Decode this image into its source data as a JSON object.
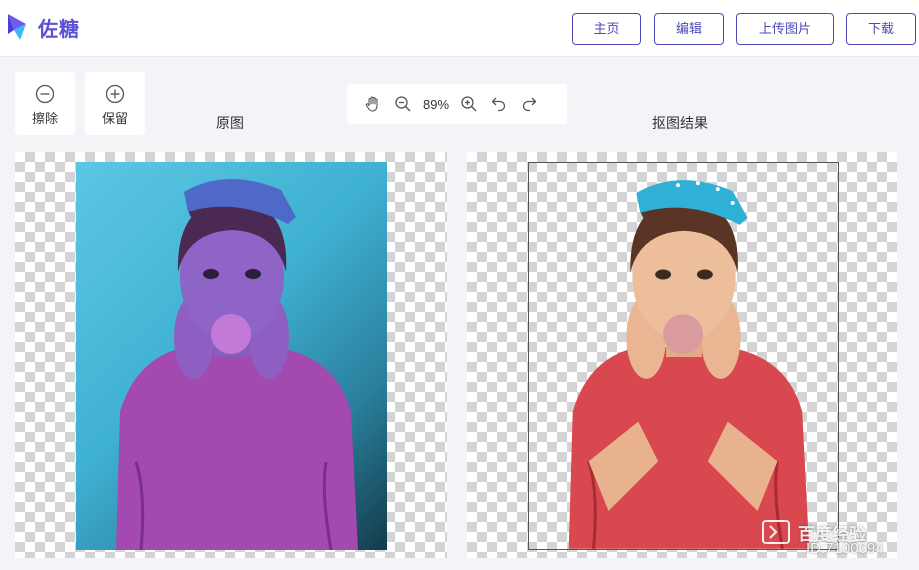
{
  "app": {
    "name": "佐糖"
  },
  "nav": {
    "home": "主页",
    "edit": "编辑",
    "upload": "上传图片",
    "download": "下载"
  },
  "tools": {
    "erase": "擦除",
    "keep": "保留"
  },
  "zoom": {
    "value": "89%"
  },
  "panes": {
    "original_title": "原图",
    "result_title": "抠图结果"
  },
  "watermark": {
    "text": "百度经验",
    "id": "ID:7100694"
  },
  "colors": {
    "brand": "#5b50d6",
    "nav_border": "#4d49b8",
    "photo_bg": "#3fb1d2"
  }
}
